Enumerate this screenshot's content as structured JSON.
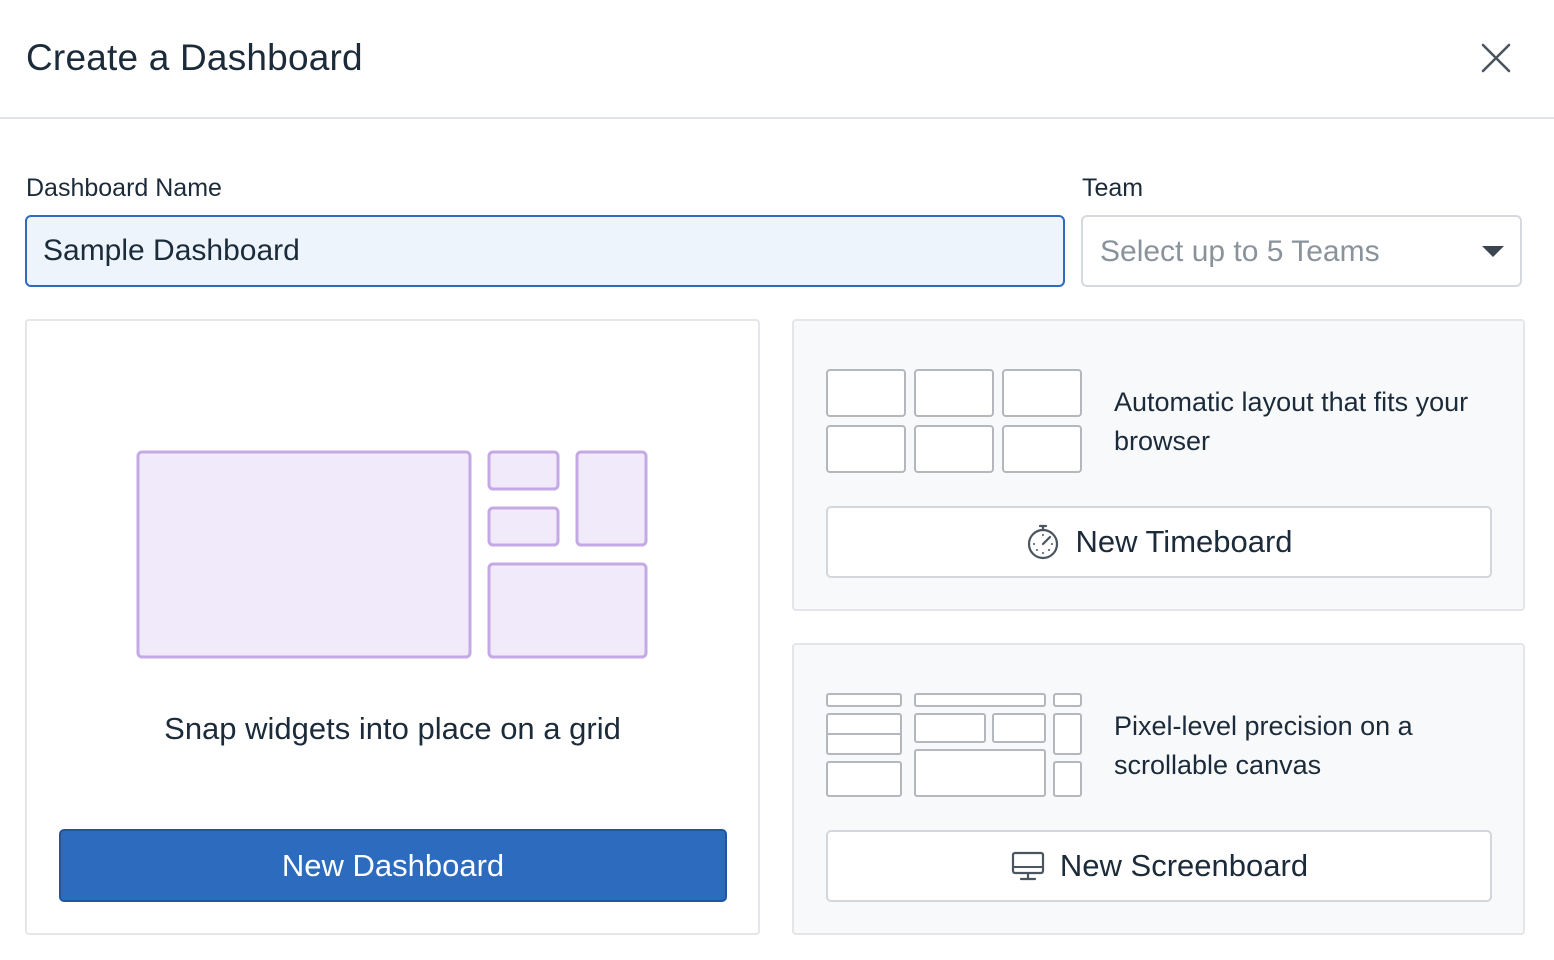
{
  "header": {
    "title": "Create a Dashboard",
    "close_icon": "close-icon"
  },
  "form": {
    "name_label": "Dashboard Name",
    "name_value": "Sample Dashboard",
    "team_label": "Team",
    "team_placeholder": "Select up to 5 Teams",
    "team_caret_icon": "chevron-down-icon"
  },
  "options": {
    "dashboard": {
      "description": "Snap widgets into place on a grid",
      "button_label": "New Dashboard",
      "illustration": "grid-layout-illustration"
    },
    "timeboard": {
      "description": "Automatic layout that fits your browser",
      "button_label": "New Timeboard",
      "button_icon": "stopwatch-icon",
      "illustration": "auto-layout-illustration"
    },
    "screenboard": {
      "description": "Pixel-level precision on a scrollable canvas",
      "button_label": "New Screenboard",
      "button_icon": "monitor-icon",
      "illustration": "freeform-layout-illustration"
    }
  },
  "colors": {
    "primary": "#2c6bbd",
    "input_focus_bg": "#edf4fc",
    "illustration_purple_fill": "#f0eafa",
    "illustration_purple_stroke": "#c4a9e4",
    "illustration_gray_stroke": "#b4b8bd",
    "card_bg": "#f8f9fb"
  }
}
